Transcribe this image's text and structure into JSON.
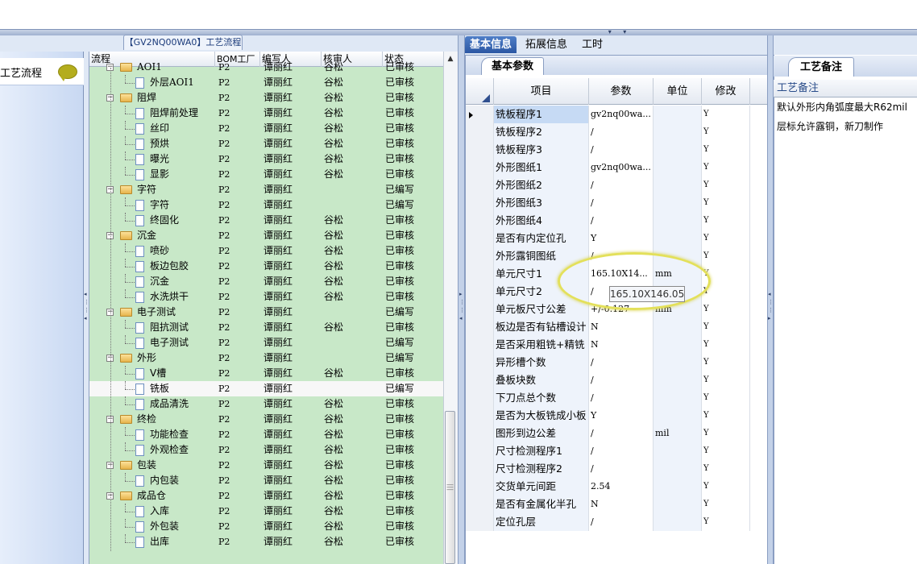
{
  "flow_panel": {
    "tab_title": "【GV2NQ00WA0】工艺流程",
    "side_label": "工艺流程"
  },
  "tree": {
    "columns": [
      "流程",
      "BOM工厂",
      "编写人",
      "核审人",
      "状态"
    ],
    "rows": [
      {
        "name": "AOI1",
        "bom": "P2",
        "writer": "谭丽红",
        "reviewer": "谷松",
        "status": "已审核",
        "level": 0,
        "type": "folder"
      },
      {
        "name": "外层AOI1",
        "bom": "P2",
        "writer": "谭丽红",
        "reviewer": "谷松",
        "status": "已审核",
        "level": 1,
        "type": "doc"
      },
      {
        "name": "阻焊",
        "bom": "P2",
        "writer": "谭丽红",
        "reviewer": "谷松",
        "status": "已审核",
        "level": 0,
        "type": "folder"
      },
      {
        "name": "阻焊前处理",
        "bom": "P2",
        "writer": "谭丽红",
        "reviewer": "谷松",
        "status": "已审核",
        "level": 1,
        "type": "doc"
      },
      {
        "name": "丝印",
        "bom": "P2",
        "writer": "谭丽红",
        "reviewer": "谷松",
        "status": "已审核",
        "level": 1,
        "type": "doc"
      },
      {
        "name": "预烘",
        "bom": "P2",
        "writer": "谭丽红",
        "reviewer": "谷松",
        "status": "已审核",
        "level": 1,
        "type": "doc"
      },
      {
        "name": "曝光",
        "bom": "P2",
        "writer": "谭丽红",
        "reviewer": "谷松",
        "status": "已审核",
        "level": 1,
        "type": "doc"
      },
      {
        "name": "显影",
        "bom": "P2",
        "writer": "谭丽红",
        "reviewer": "谷松",
        "status": "已审核",
        "level": 1,
        "type": "doc"
      },
      {
        "name": "字符",
        "bom": "P2",
        "writer": "谭丽红",
        "reviewer": "",
        "status": "已编写",
        "level": 0,
        "type": "folder"
      },
      {
        "name": "字符",
        "bom": "P2",
        "writer": "谭丽红",
        "reviewer": "",
        "status": "已编写",
        "level": 1,
        "type": "doc"
      },
      {
        "name": "终固化",
        "bom": "P2",
        "writer": "谭丽红",
        "reviewer": "谷松",
        "status": "已审核",
        "level": 1,
        "type": "doc"
      },
      {
        "name": "沉金",
        "bom": "P2",
        "writer": "谭丽红",
        "reviewer": "谷松",
        "status": "已审核",
        "level": 0,
        "type": "folder"
      },
      {
        "name": "喷砂",
        "bom": "P2",
        "writer": "谭丽红",
        "reviewer": "谷松",
        "status": "已审核",
        "level": 1,
        "type": "doc"
      },
      {
        "name": "板边包胶",
        "bom": "P2",
        "writer": "谭丽红",
        "reviewer": "谷松",
        "status": "已审核",
        "level": 1,
        "type": "doc"
      },
      {
        "name": "沉金",
        "bom": "P2",
        "writer": "谭丽红",
        "reviewer": "谷松",
        "status": "已审核",
        "level": 1,
        "type": "doc"
      },
      {
        "name": "水洗烘干",
        "bom": "P2",
        "writer": "谭丽红",
        "reviewer": "谷松",
        "status": "已审核",
        "level": 1,
        "type": "doc"
      },
      {
        "name": "电子测试",
        "bom": "P2",
        "writer": "谭丽红",
        "reviewer": "",
        "status": "已编写",
        "level": 0,
        "type": "folder"
      },
      {
        "name": "阻抗测试",
        "bom": "P2",
        "writer": "谭丽红",
        "reviewer": "谷松",
        "status": "已审核",
        "level": 1,
        "type": "doc"
      },
      {
        "name": "电子测试",
        "bom": "P2",
        "writer": "谭丽红",
        "reviewer": "",
        "status": "已编写",
        "level": 1,
        "type": "doc"
      },
      {
        "name": "外形",
        "bom": "P2",
        "writer": "谭丽红",
        "reviewer": "",
        "status": "已编写",
        "level": 0,
        "type": "folder"
      },
      {
        "name": "V槽",
        "bom": "P2",
        "writer": "谭丽红",
        "reviewer": "谷松",
        "status": "已审核",
        "level": 1,
        "type": "doc"
      },
      {
        "name": "铣板",
        "bom": "P2",
        "writer": "谭丽红",
        "reviewer": "",
        "status": "已编写",
        "level": 1,
        "type": "doc",
        "selected": true
      },
      {
        "name": "成品清洗",
        "bom": "P2",
        "writer": "谭丽红",
        "reviewer": "谷松",
        "status": "已审核",
        "level": 1,
        "type": "doc"
      },
      {
        "name": "终检",
        "bom": "P2",
        "writer": "谭丽红",
        "reviewer": "谷松",
        "status": "已审核",
        "level": 0,
        "type": "folder"
      },
      {
        "name": "功能检查",
        "bom": "P2",
        "writer": "谭丽红",
        "reviewer": "谷松",
        "status": "已审核",
        "level": 1,
        "type": "doc"
      },
      {
        "name": "外观检查",
        "bom": "P2",
        "writer": "谭丽红",
        "reviewer": "谷松",
        "status": "已审核",
        "level": 1,
        "type": "doc"
      },
      {
        "name": "包装",
        "bom": "P2",
        "writer": "谭丽红",
        "reviewer": "谷松",
        "status": "已审核",
        "level": 0,
        "type": "folder"
      },
      {
        "name": "内包装",
        "bom": "P2",
        "writer": "谭丽红",
        "reviewer": "谷松",
        "status": "已审核",
        "level": 1,
        "type": "doc"
      },
      {
        "name": "成品仓",
        "bom": "P2",
        "writer": "谭丽红",
        "reviewer": "谷松",
        "status": "已审核",
        "level": 0,
        "type": "folder"
      },
      {
        "name": "入库",
        "bom": "P2",
        "writer": "谭丽红",
        "reviewer": "谷松",
        "status": "已审核",
        "level": 1,
        "type": "doc"
      },
      {
        "name": "外包装",
        "bom": "P2",
        "writer": "谭丽红",
        "reviewer": "谷松",
        "status": "已审核",
        "level": 1,
        "type": "doc"
      },
      {
        "name": "出库",
        "bom": "P2",
        "writer": "谭丽红",
        "reviewer": "谷松",
        "status": "已审核",
        "level": 1,
        "type": "doc"
      }
    ]
  },
  "tabs": [
    "基本信息",
    "拓展信息",
    "工时"
  ],
  "param_panel": {
    "tab_label": "基本参数",
    "columns": [
      "项目",
      "参数",
      "单位",
      "修改"
    ],
    "rows": [
      {
        "item": "铣板程序1",
        "value": "gv2nq00wa...",
        "unit": "",
        "mod": "Y"
      },
      {
        "item": "铣板程序2",
        "value": "/",
        "unit": "",
        "mod": "Y"
      },
      {
        "item": "铣板程序3",
        "value": "/",
        "unit": "",
        "mod": "Y"
      },
      {
        "item": "外形图纸1",
        "value": "gv2nq00wa...",
        "unit": "",
        "mod": "Y"
      },
      {
        "item": "外形图纸2",
        "value": "/",
        "unit": "",
        "mod": "Y"
      },
      {
        "item": "外形图纸3",
        "value": "/",
        "unit": "",
        "mod": "Y"
      },
      {
        "item": "外形图纸4",
        "value": "/",
        "unit": "",
        "mod": "Y"
      },
      {
        "item": "是否有内定位孔",
        "value": "Y",
        "unit": "",
        "mod": "Y"
      },
      {
        "item": "外形露铜图纸",
        "value": "/",
        "unit": "",
        "mod": "Y"
      },
      {
        "item": "单元尺寸1",
        "value": "165.10X14...",
        "unit": "mm",
        "mod": "Y"
      },
      {
        "item": "单元尺寸2",
        "value": "/",
        "unit": "",
        "mod": "Y"
      },
      {
        "item": "单元板尺寸公差",
        "value": "+/-0.127",
        "unit": "mm",
        "mod": "Y"
      },
      {
        "item": "板边是否有钻槽设计",
        "value": "N",
        "unit": "",
        "mod": "Y"
      },
      {
        "item": "是否采用粗铣+精铣",
        "value": "N",
        "unit": "",
        "mod": "Y"
      },
      {
        "item": "异形槽个数",
        "value": "/",
        "unit": "",
        "mod": "Y"
      },
      {
        "item": "叠板块数",
        "value": "/",
        "unit": "",
        "mod": "Y"
      },
      {
        "item": "下刀点总个数",
        "value": "/",
        "unit": "",
        "mod": "Y"
      },
      {
        "item": "是否为大板铣成小板",
        "value": "Y",
        "unit": "",
        "mod": "Y"
      },
      {
        "item": "图形到边公差",
        "value": "/",
        "unit": "mil",
        "mod": "Y"
      },
      {
        "item": "尺寸检测程序1",
        "value": "/",
        "unit": "",
        "mod": "Y"
      },
      {
        "item": "尺寸检测程序2",
        "value": "/",
        "unit": "",
        "mod": "Y"
      },
      {
        "item": "交货单元间距",
        "value": "2.54",
        "unit": "",
        "mod": "Y"
      },
      {
        "item": "是否有金属化半孔",
        "value": "N",
        "unit": "",
        "mod": "Y"
      },
      {
        "item": "定位孔层",
        "value": "/",
        "unit": "",
        "mod": "Y"
      }
    ],
    "tooltip": "165.10X146.05"
  },
  "remark_panel": {
    "tab_label": "工艺备注",
    "header": "工艺备注",
    "lines": [
      "默认外形内角弧度最大R62mil",
      "层标允许露铜，新刀制作"
    ]
  }
}
